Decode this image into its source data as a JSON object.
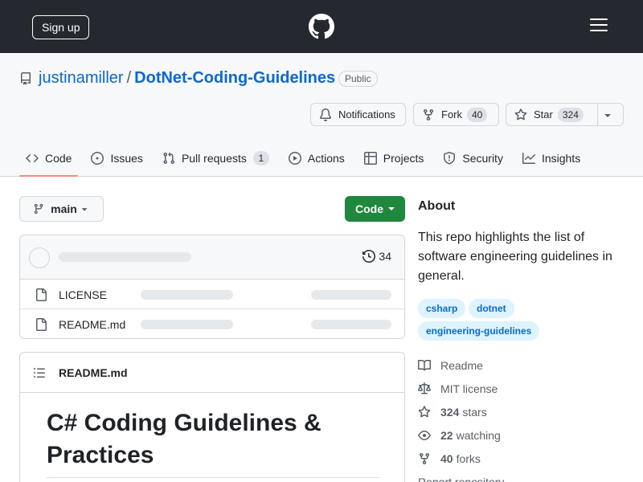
{
  "header": {
    "signup_label": "Sign up"
  },
  "repo": {
    "owner": "justinamiller",
    "separator": "/",
    "name": "DotNet-Coding-Guidelines",
    "visibility": "Public"
  },
  "actions": {
    "notifications_label": "Notifications",
    "fork_label": "Fork",
    "fork_count": "40",
    "star_label": "Star",
    "star_count": "324"
  },
  "tabs": [
    {
      "label": "Code",
      "icon": "code-icon",
      "active": true
    },
    {
      "label": "Issues",
      "icon": "issue-icon"
    },
    {
      "label": "Pull requests",
      "icon": "pull-request-icon",
      "count": "1"
    },
    {
      "label": "Actions",
      "icon": "play-icon"
    },
    {
      "label": "Projects",
      "icon": "table-icon"
    },
    {
      "label": "Security",
      "icon": "shield-icon"
    },
    {
      "label": "Insights",
      "icon": "graph-icon"
    }
  ],
  "branch": {
    "label": "main"
  },
  "code_button": {
    "label": "Code"
  },
  "files": {
    "commit_count": "34",
    "items": [
      {
        "name": "LICENSE",
        "icon": "file-icon"
      },
      {
        "name": "README.md",
        "icon": "file-icon"
      }
    ]
  },
  "readme": {
    "filename": "README.md",
    "heading": "C# Coding Guidelines & Practices"
  },
  "about": {
    "title": "About",
    "description": "This repo highlights the list of software engineering guidelines in general.",
    "topics": [
      "csharp",
      "dotnet",
      "engineering-guidelines"
    ],
    "meta": [
      {
        "icon": "book-icon",
        "text": "Readme"
      },
      {
        "icon": "law-icon",
        "text": "MIT license"
      },
      {
        "icon": "star-icon",
        "value": "324",
        "text": "stars"
      },
      {
        "icon": "eye-icon",
        "value": "22",
        "text": "watching"
      },
      {
        "icon": "fork-icon",
        "value": "40",
        "text": "forks"
      }
    ],
    "report_label": "Report repository"
  },
  "colors": {
    "header_bg": "#24292f",
    "link": "#0969da",
    "primary_button": "#1f883d",
    "active_tab_underline": "#fd8c73",
    "topic_bg": "#ddf4ff"
  }
}
